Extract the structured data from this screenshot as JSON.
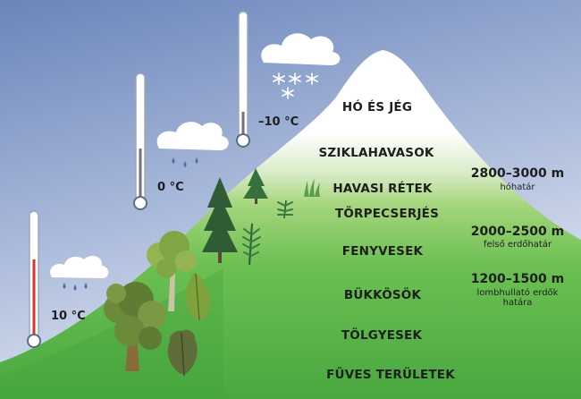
{
  "zones": [
    "HÓ ÉS JÉG",
    "SZIKLAHAVASOK",
    "HAVASI RÉTEK",
    "TÖRPECSERJÉS",
    "FENYVESEK",
    "BÜKKÖSÖK",
    "TÖLGYESEK",
    "FÜVES TERÜLETEK"
  ],
  "temperatures": [
    "10 °C",
    "0 °C",
    "–10 °C"
  ],
  "boundaries": [
    {
      "altitude": "2800–3000 m",
      "note": "hóhatár"
    },
    {
      "altitude": "2000–2500 m",
      "note": "felső erdőhatár"
    },
    {
      "altitude": "1200–1500 m",
      "note_line1": "lombhullató erdők",
      "note_line2": "határa"
    }
  ],
  "weather": [
    "rain-cloud-icon",
    "rain-cloud-icon",
    "snow-cloud-icon"
  ],
  "colors": {
    "sky_top": "#6b86bb",
    "sky_bottom": "#d6deee",
    "grass": "#4fb24a",
    "snow": "#ffffff",
    "thermometer_red": "#d9362b"
  }
}
